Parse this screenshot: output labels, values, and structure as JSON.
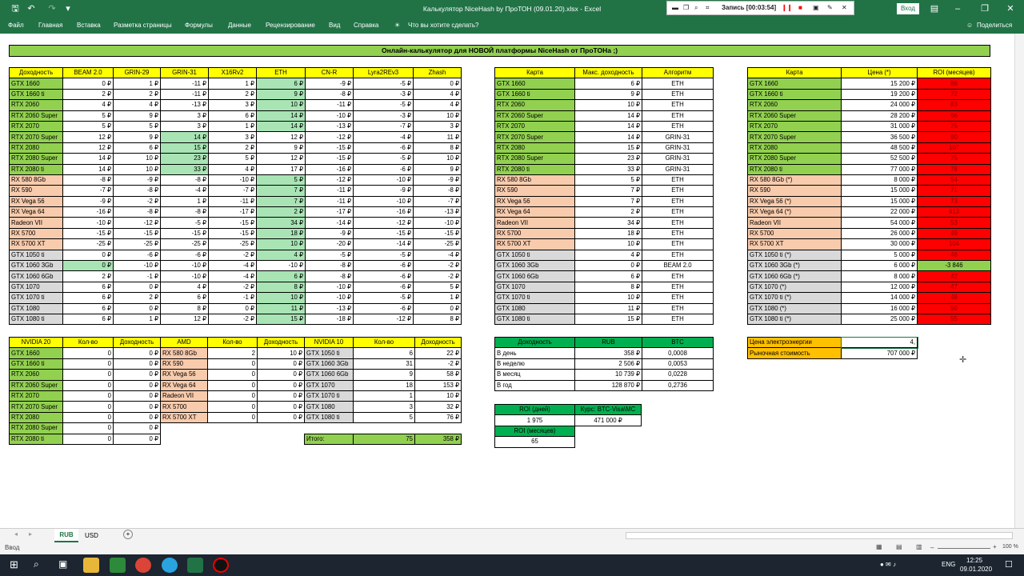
{
  "window": {
    "title": "Калькулятор  NiceHash by ПроТОН (09.01.20).xlsx  -  Excel",
    "login": "Вход",
    "recording": "Запись [00:03:54]"
  },
  "ribbon": {
    "tabs": [
      "Файл",
      "Главная",
      "Вставка",
      "Разметка страницы",
      "Формулы",
      "Данные",
      "Рецензирование",
      "Вид",
      "Справка"
    ],
    "tell": "Что вы хотите сделать?",
    "share": "Поделиться"
  },
  "banner": "Онлайн-калькулятор для НОВОЙ платформы NiceHash от ПроТОНа ;)",
  "algo": {
    "headers": [
      "Доходность",
      "BEAM 2.0",
      "GRIN-29",
      "GRIN-31",
      "X16Rv2",
      "ETH",
      "CN-R",
      "Lyra2REv3",
      "Zhash"
    ],
    "rows": [
      {
        "k": "gr",
        "c": [
          "GTX 1660",
          "0 ₽",
          "1 ₽",
          "-11 ₽",
          "1 ₽",
          "6 ₽",
          "-9 ₽",
          "-5 ₽",
          "0 ₽"
        ],
        "h": [
          5
        ]
      },
      {
        "k": "gr",
        "c": [
          "GTX 1660 ti",
          "2 ₽",
          "2 ₽",
          "-11 ₽",
          "2 ₽",
          "9 ₽",
          "-8 ₽",
          "-3 ₽",
          "4 ₽"
        ],
        "h": [
          5
        ]
      },
      {
        "k": "gr",
        "c": [
          "RTX 2060",
          "4 ₽",
          "4 ₽",
          "-13 ₽",
          "3 ₽",
          "10 ₽",
          "-11 ₽",
          "-5 ₽",
          "4 ₽"
        ],
        "h": [
          5
        ]
      },
      {
        "k": "gr",
        "c": [
          "RTX 2060 Super",
          "5 ₽",
          "9 ₽",
          "3 ₽",
          "6 ₽",
          "14 ₽",
          "-10 ₽",
          "-3 ₽",
          "10 ₽"
        ],
        "h": [
          5
        ]
      },
      {
        "k": "gr",
        "c": [
          "RTX 2070",
          "5 ₽",
          "5 ₽",
          "3 ₽",
          "1 ₽",
          "14 ₽",
          "-13 ₽",
          "-7 ₽",
          "3 ₽"
        ],
        "h": [
          5
        ]
      },
      {
        "k": "gr",
        "c": [
          "RTX 2070 Super",
          "12 ₽",
          "9 ₽",
          "14 ₽",
          "3 ₽",
          "12 ₽",
          "-12 ₽",
          "-4 ₽",
          "11 ₽"
        ],
        "h": [
          3
        ]
      },
      {
        "k": "gr",
        "c": [
          "RTX 2080",
          "12 ₽",
          "6 ₽",
          "15 ₽",
          "2 ₽",
          "9 ₽",
          "-15 ₽",
          "-6 ₽",
          "8 ₽"
        ],
        "h": [
          3
        ]
      },
      {
        "k": "gr",
        "c": [
          "RTX 2080 Super",
          "14 ₽",
          "10 ₽",
          "23 ₽",
          "5 ₽",
          "12 ₽",
          "-15 ₽",
          "-5 ₽",
          "10 ₽"
        ],
        "h": [
          3
        ]
      },
      {
        "k": "gr",
        "c": [
          "RTX 2080 ti",
          "14 ₽",
          "10 ₽",
          "33 ₽",
          "4 ₽",
          "17 ₽",
          "-16 ₽",
          "-6 ₽",
          "9 ₽"
        ],
        "h": [
          3
        ]
      },
      {
        "k": "or",
        "c": [
          "RX 580 8Gb",
          "-8 ₽",
          "-9 ₽",
          "-8 ₽",
          "-10 ₽",
          "5 ₽",
          "-12 ₽",
          "-10 ₽",
          "-9 ₽"
        ],
        "h": [
          5
        ]
      },
      {
        "k": "or",
        "c": [
          "RX 590",
          "-7 ₽",
          "-8 ₽",
          "-4 ₽",
          "-7 ₽",
          "7 ₽",
          "-11 ₽",
          "-9 ₽",
          "-8 ₽"
        ],
        "h": [
          5
        ]
      },
      {
        "k": "or",
        "c": [
          "RX Vega 56",
          "-9 ₽",
          "-2 ₽",
          "1 ₽",
          "-11 ₽",
          "7 ₽",
          "-11 ₽",
          "-10 ₽",
          "-7 ₽"
        ],
        "h": [
          5
        ]
      },
      {
        "k": "or",
        "c": [
          "RX Vega 64",
          "-16 ₽",
          "-8 ₽",
          "-8 ₽",
          "-17 ₽",
          "2 ₽",
          "-17 ₽",
          "-16 ₽",
          "-13 ₽"
        ],
        "h": [
          5
        ]
      },
      {
        "k": "or",
        "c": [
          "Radeon VII",
          "-10 ₽",
          "-12 ₽",
          "-5 ₽",
          "-15 ₽",
          "34 ₽",
          "-14 ₽",
          "-12 ₽",
          "-10 ₽"
        ],
        "h": [
          5
        ]
      },
      {
        "k": "or",
        "c": [
          "RX 5700",
          "-15 ₽",
          "-15 ₽",
          "-15 ₽",
          "-15 ₽",
          "18 ₽",
          "-9 ₽",
          "-15 ₽",
          "-15 ₽"
        ],
        "h": [
          5
        ]
      },
      {
        "k": "or",
        "c": [
          "RX 5700 XT",
          "-25 ₽",
          "-25 ₽",
          "-25 ₽",
          "-25 ₽",
          "10 ₽",
          "-20 ₽",
          "-14 ₽",
          "-25 ₽"
        ],
        "h": [
          5
        ]
      },
      {
        "k": "gy",
        "c": [
          "GTX 1050 ti",
          "0 ₽",
          "-6 ₽",
          "-6 ₽",
          "-2 ₽",
          "4 ₽",
          "-5 ₽",
          "-5 ₽",
          "-4 ₽"
        ],
        "h": [
          5
        ]
      },
      {
        "k": "gy",
        "c": [
          "GTX 1060 3Gb",
          "0 ₽",
          "-10 ₽",
          "-10 ₽",
          "-4 ₽",
          "-10 ₽",
          "-8 ₽",
          "-6 ₽",
          "-2 ₽"
        ],
        "h": [
          1
        ]
      },
      {
        "k": "gy",
        "c": [
          "GTX 1060 6Gb",
          "2 ₽",
          "-1 ₽",
          "-10 ₽",
          "-4 ₽",
          "6 ₽",
          "-8 ₽",
          "-6 ₽",
          "-2 ₽"
        ],
        "h": [
          5
        ]
      },
      {
        "k": "gy",
        "c": [
          "GTX 1070",
          "6 ₽",
          "0 ₽",
          "4 ₽",
          "-2 ₽",
          "8 ₽",
          "-10 ₽",
          "-6 ₽",
          "5 ₽"
        ],
        "h": [
          5
        ]
      },
      {
        "k": "gy",
        "c": [
          "GTX 1070 ti",
          "6 ₽",
          "2 ₽",
          "6 ₽",
          "-1 ₽",
          "10 ₽",
          "-10 ₽",
          "-5 ₽",
          "1 ₽"
        ],
        "h": [
          5
        ]
      },
      {
        "k": "gy",
        "c": [
          "GTX 1080",
          "6 ₽",
          "0 ₽",
          "8 ₽",
          "0 ₽",
          "11 ₽",
          "-13 ₽",
          "-6 ₽",
          "0 ₽"
        ],
        "h": [
          5
        ]
      },
      {
        "k": "gy",
        "c": [
          "GTX 1080 ti",
          "6 ₽",
          "1 ₽",
          "12 ₽",
          "-2 ₽",
          "15 ₽",
          "-18 ₽",
          "-12 ₽",
          "8 ₽"
        ],
        "h": [
          5
        ]
      }
    ]
  },
  "best": {
    "headers": [
      "Карта",
      "Макс. доходность",
      "Алгоритм"
    ],
    "rows": [
      [
        "GTX 1660",
        "6 ₽",
        "ETH"
      ],
      [
        "GTX 1660 ti",
        "9 ₽",
        "ETH"
      ],
      [
        "RTX 2060",
        "10 ₽",
        "ETH"
      ],
      [
        "RTX 2060 Super",
        "14 ₽",
        "ETH"
      ],
      [
        "RTX 2070",
        "14 ₽",
        "ETH"
      ],
      [
        "RTX 2070 Super",
        "14 ₽",
        "GRIN-31"
      ],
      [
        "RTX 2080",
        "15 ₽",
        "GRIN-31"
      ],
      [
        "RTX 2080 Super",
        "23 ₽",
        "GRIN-31"
      ],
      [
        "RTX 2080 ti",
        "33 ₽",
        "GRIN-31"
      ],
      [
        "RX 580 8Gb",
        "5 ₽",
        "ETH"
      ],
      [
        "RX 590",
        "7 ₽",
        "ETH"
      ],
      [
        "RX Vega 56",
        "7 ₽",
        "ETH"
      ],
      [
        "RX Vega 64",
        "2 ₽",
        "ETH"
      ],
      [
        "Radeon VII",
        "34 ₽",
        "ETH"
      ],
      [
        "RX 5700",
        "18 ₽",
        "ETH"
      ],
      [
        "RX 5700 XT",
        "10 ₽",
        "ETH"
      ],
      [
        "GTX 1050 ti",
        "4 ₽",
        "ETH"
      ],
      [
        "GTX 1060 3Gb",
        "0 ₽",
        "BEAM 2.0"
      ],
      [
        "GTX 1060 6Gb",
        "6 ₽",
        "ETH"
      ],
      [
        "GTX 1070",
        "8 ₽",
        "ETH"
      ],
      [
        "GTX 1070 ti",
        "10 ₽",
        "ETH"
      ],
      [
        "GTX 1080",
        "11 ₽",
        "ETH"
      ],
      [
        "GTX 1080 ti",
        "15 ₽",
        "ETH"
      ]
    ]
  },
  "roi": {
    "headers": [
      "Карта",
      "Цена (*)",
      "ROI (месяцев)"
    ],
    "rows": [
      [
        "GTX 1660",
        "15 200 ₽",
        "86"
      ],
      [
        "GTX 1660 ti",
        "19 200 ₽",
        "72"
      ],
      [
        "RTX 2060",
        "24 000 ₽",
        "83"
      ],
      [
        "RTX 2060 Super",
        "28 200 ₽",
        "66"
      ],
      [
        "RTX 2070",
        "31 000 ₽",
        "75"
      ],
      [
        "RTX 2070 Super",
        "36 500 ₽",
        "90"
      ],
      [
        "RTX 2080",
        "48 500 ₽",
        "107"
      ],
      [
        "RTX 2080 Super",
        "52 500 ₽",
        "75"
      ],
      [
        "RTX 2080 ti",
        "77 000 ₽",
        "78"
      ],
      [
        "RX 580 8Gb (*)",
        "8 000 ₽",
        "54"
      ],
      [
        "RX 590",
        "15 000 ₽",
        "71"
      ],
      [
        "RX Vega 56 (*)",
        "15 000 ₽",
        "73"
      ],
      [
        "RX Vega 64 (*)",
        "22 000 ₽",
        "413"
      ],
      [
        "Radeon VII",
        "54 000 ₽",
        "53"
      ],
      [
        "RX 5700",
        "26 000 ₽",
        "49"
      ],
      [
        "RX 5700 XT",
        "30 000 ₽",
        "104"
      ],
      [
        "GTX 1050 ti (*)",
        "5 000 ₽",
        "46"
      ],
      [
        "GTX 1060 3Gb (*)",
        "6 000 ₽",
        "-3 846"
      ],
      [
        "GTX 1060 6Gb (*)",
        "8 000 ₽",
        "42"
      ],
      [
        "GTX 1070 (*)",
        "12 000 ₽",
        "47"
      ],
      [
        "GTX 1070 ti (*)",
        "14 000 ₽",
        "48"
      ],
      [
        "GTX 1080 (*)",
        "16 000 ₽",
        "50"
      ],
      [
        "GTX 1080 ti (*)",
        "25 000 ₽",
        "55"
      ]
    ]
  },
  "nv20": {
    "headers": [
      "NVIDIA 20",
      "Кол-во",
      "Доходность"
    ],
    "rows": [
      [
        "GTX 1660",
        "0",
        "0 ₽"
      ],
      [
        "GTX 1660 ti",
        "0",
        "0 ₽"
      ],
      [
        "RTX 2060",
        "0",
        "0 ₽"
      ],
      [
        "RTX 2060 Super",
        "0",
        "0 ₽"
      ],
      [
        "RTX 2070",
        "0",
        "0 ₽"
      ],
      [
        "RTX 2070 Super",
        "0",
        "0 ₽"
      ],
      [
        "RTX 2080",
        "0",
        "0 ₽"
      ],
      [
        "RTX 2080 Super",
        "0",
        "0 ₽"
      ],
      [
        "RTX 2080 ti",
        "0",
        "0 ₽"
      ]
    ]
  },
  "amd": {
    "headers": [
      "AMD",
      "Кол-во",
      "Доходность"
    ],
    "rows": [
      [
        "RX 580 8Gb",
        "2",
        "10 ₽"
      ],
      [
        "RX 590",
        "0",
        "0 ₽"
      ],
      [
        "RX Vega 56",
        "0",
        "0 ₽"
      ],
      [
        "RX Vega 64",
        "0",
        "0 ₽"
      ],
      [
        "Radeon VII",
        "0",
        "0 ₽"
      ],
      [
        "RX 5700",
        "0",
        "0 ₽"
      ],
      [
        "RX 5700 XT",
        "0",
        "0 ₽"
      ]
    ]
  },
  "nv10": {
    "headers": [
      "NVIDIA 10",
      "Кол-во",
      "Доходность"
    ],
    "rows": [
      [
        "GTX 1050 ti",
        "6",
        "22 ₽"
      ],
      [
        "GTX 1060 3Gb",
        "31",
        "-2 ₽"
      ],
      [
        "GTX 1060 6Gb",
        "9",
        "58 ₽"
      ],
      [
        "GTX 1070",
        "18",
        "153 ₽"
      ],
      [
        "GTX 1070 ti",
        "1",
        "10 ₽"
      ],
      [
        "GTX 1080",
        "3",
        "32 ₽"
      ],
      [
        "GTX 1080 ti",
        "5",
        "76 ₽"
      ]
    ],
    "total_label": "Итого:",
    "total_count": "75",
    "total_income": "358 ₽"
  },
  "income": {
    "headers": [
      "Доходность",
      "RUB",
      "BTC"
    ],
    "rows": [
      [
        "В день",
        "358 ₽",
        "0,0008"
      ],
      [
        "В неделю",
        "2 506 ₽",
        "0,0053"
      ],
      [
        "В месяц",
        "10 739 ₽",
        "0,0228"
      ],
      [
        "В год",
        "128 870 ₽",
        "0,2736"
      ]
    ]
  },
  "roiSummary": {
    "days_label": "ROI (дней)",
    "rate_label": "Курс: BTC-Visa\\MC",
    "days": "1 975",
    "rate": "471 000 ₽",
    "months_label": "ROI (месяцев)",
    "months": "65"
  },
  "energy": {
    "label": "Цена электроэнергии",
    "value": "4,",
    "market_label": "Рыночная стоимость",
    "market": "707 000 ₽"
  },
  "tabs": {
    "active": "RUB",
    "other": "USD"
  },
  "status": {
    "mode": "Ввод",
    "zoom": "100 %"
  },
  "taskbar": {
    "lang": "ENG",
    "time": "12:25",
    "date": "09.01.2020"
  }
}
